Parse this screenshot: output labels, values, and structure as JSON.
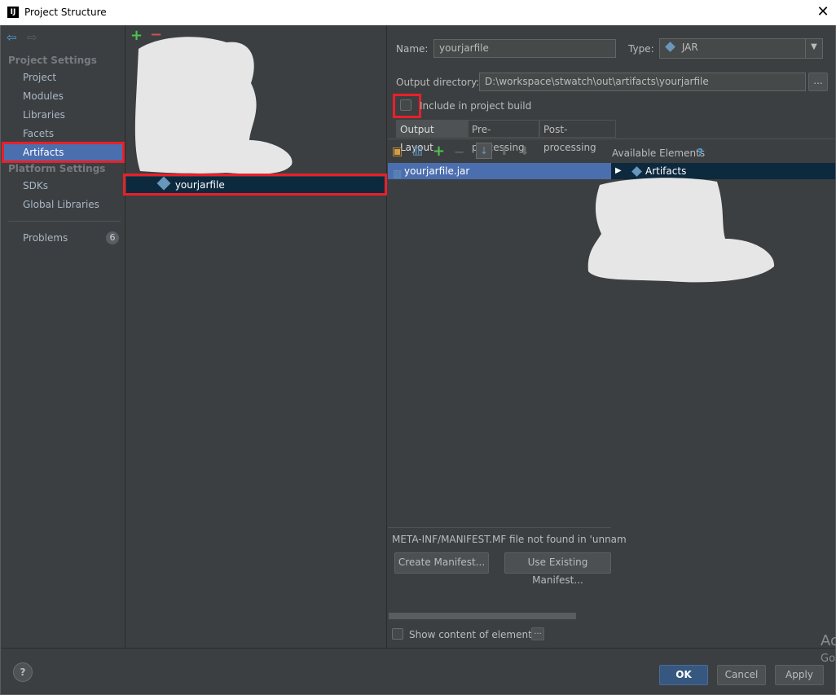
{
  "window": {
    "title": "Project Structure",
    "logo": "IJ"
  },
  "sidebar": {
    "project_settings_title": "Project Settings",
    "platform_settings_title": "Platform Settings",
    "items": [
      "Project",
      "Modules",
      "Libraries",
      "Facets",
      "Artifacts"
    ],
    "platform_items": [
      "SDKs",
      "Global Libraries"
    ],
    "problems_label": "Problems",
    "problems_count": "6"
  },
  "artifacts_list": {
    "selected_item": "yourjarfile"
  },
  "details": {
    "name_label": "Name:",
    "name_value": "yourjarfile",
    "type_label": "Type:",
    "type_value": "JAR",
    "output_dir_label": "Output directory:",
    "output_dir_value": "D:\\workspace\\stwatch\\out\\artifacts\\yourjarfile",
    "browse_label": "...",
    "include_build_label": "Include in project build",
    "tabs": [
      "Output Layout",
      "Pre-processing",
      "Post-processing"
    ],
    "layout_root": "yourjarfile.jar",
    "available_elements_label": "Available Elements",
    "available_help": "?",
    "available_root": "Artifacts",
    "manifest_warning": "META-INF/MANIFEST.MF file not found in 'unnam",
    "create_manifest": "Create Manifest...",
    "use_existing_manifest": "Use Existing Manifest...",
    "show_content_label": "Show content of elements",
    "show_content_more": "..."
  },
  "footer": {
    "ok": "OK",
    "cancel": "Cancel",
    "apply": "Apply",
    "help": "?"
  },
  "watermark": {
    "line1": "Ac",
    "line2": "Go"
  },
  "colors": {
    "selection": "#4b6eaf",
    "highlight": "#e8202a",
    "background": "#3c3f41"
  }
}
